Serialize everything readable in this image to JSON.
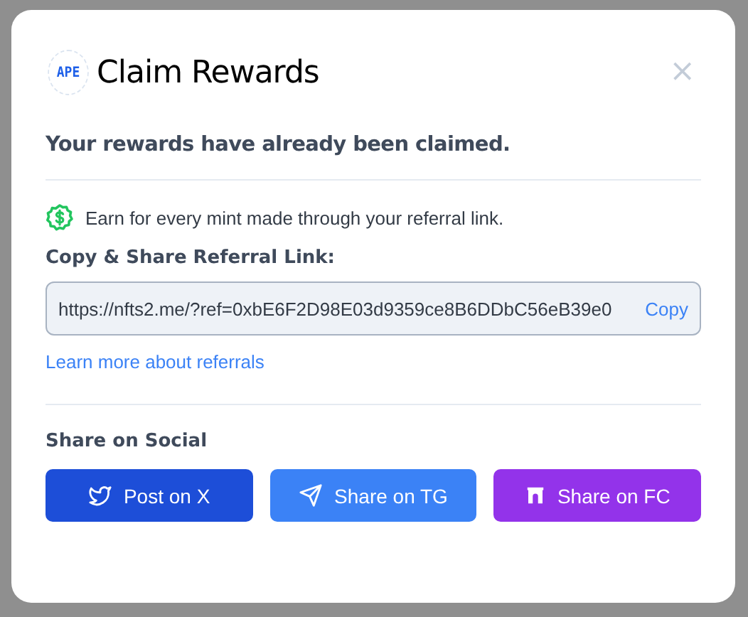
{
  "dialog": {
    "logo": "APE",
    "title": "Claim Rewards",
    "close": "×",
    "status": "Your rewards have already been claimed.",
    "earn_note": "Earn for every mint made through your referral link.",
    "link_label": "Copy & Share Referral Link:",
    "link_value": "https://nfts2.me/?ref=0xbE6F2D98E03d9359ce8B6DDbC56eB39e0",
    "copy_button": "Copy",
    "learn_more": "Learn more about referrals",
    "social_heading": "Share on Social",
    "social_buttons": [
      {
        "kind": "x",
        "label": "Post on X",
        "color": "#1d4ed8"
      },
      {
        "kind": "telegram",
        "label": "Share on TG",
        "color": "#3b82f6"
      },
      {
        "kind": "farcaster",
        "label": "Share on FC",
        "color": "#9333ea"
      }
    ]
  }
}
